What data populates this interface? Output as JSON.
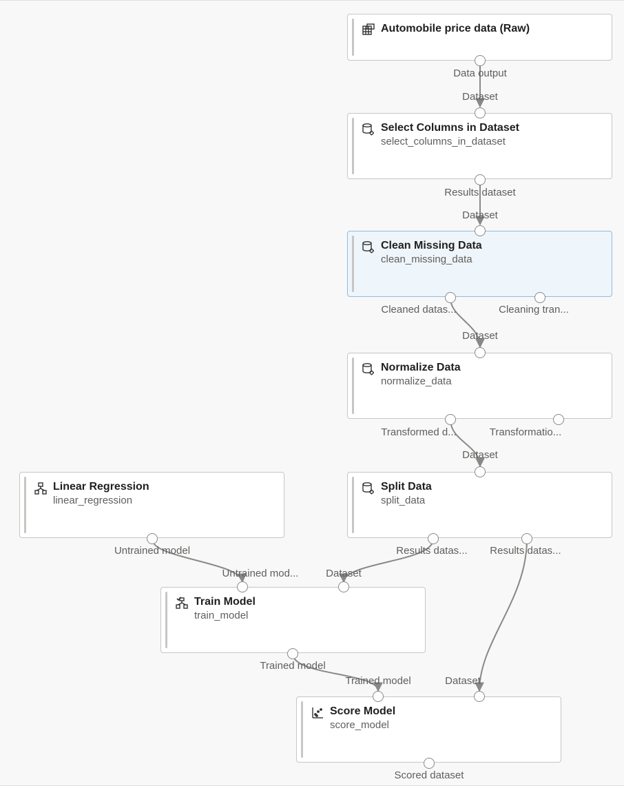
{
  "nodes": {
    "automobile": {
      "title": "Automobile price data (Raw)",
      "outputs": {
        "out0": "Data output"
      }
    },
    "select_columns": {
      "title": "Select Columns in Dataset",
      "subtitle": "select_columns_in_dataset",
      "inputs": {
        "in0": "Dataset"
      },
      "outputs": {
        "out0": "Results dataset"
      }
    },
    "clean_missing": {
      "title": "Clean Missing Data",
      "subtitle": "clean_missing_data",
      "inputs": {
        "in0": "Dataset"
      },
      "outputs": {
        "out0": "Cleaned datas...",
        "out1": "Cleaning tran..."
      }
    },
    "normalize": {
      "title": "Normalize Data",
      "subtitle": "normalize_data",
      "inputs": {
        "in0": "Dataset"
      },
      "outputs": {
        "out0": "Transformed d...",
        "out1": "Transformatio..."
      }
    },
    "linear_regression": {
      "title": "Linear Regression",
      "subtitle": "linear_regression",
      "outputs": {
        "out0": "Untrained model"
      }
    },
    "split_data": {
      "title": "Split Data",
      "subtitle": "split_data",
      "inputs": {
        "in0": "Dataset"
      },
      "outputs": {
        "out0": "Results datas...",
        "out1": "Results datas..."
      }
    },
    "train_model": {
      "title": "Train Model",
      "subtitle": "train_model",
      "inputs": {
        "in0": "Untrained mod...",
        "in1": "Dataset"
      },
      "outputs": {
        "out0": "Trained model"
      }
    },
    "score_model": {
      "title": "Score Model",
      "subtitle": "score_model",
      "inputs": {
        "in0": "Trained model",
        "in1": "Dataset"
      },
      "outputs": {
        "out0": "Scored dataset"
      }
    }
  }
}
